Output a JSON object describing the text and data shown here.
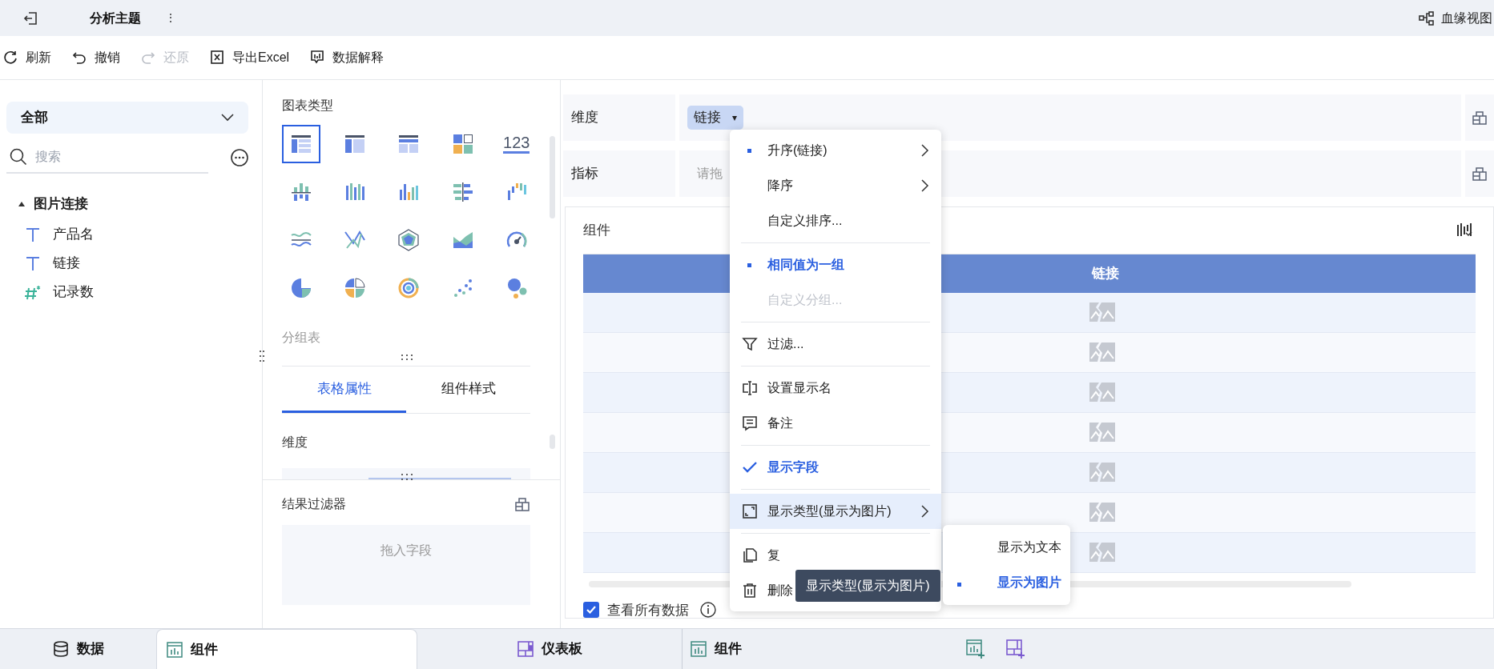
{
  "header": {
    "title": "分析主题",
    "more": "⋮",
    "lineage": "血缘视图"
  },
  "toolbar": [
    {
      "label": "刷新",
      "disabled": false
    },
    {
      "label": "撤销",
      "disabled": false
    },
    {
      "label": "还原",
      "disabled": true
    },
    {
      "label": "导出Excel",
      "disabled": false
    },
    {
      "label": "数据解释",
      "disabled": false
    }
  ],
  "sidebar": {
    "scope": "全部",
    "search": {
      "placeholder": "搜索"
    },
    "tree": [
      {
        "label": "图片连接",
        "expanded": true,
        "children": [
          {
            "label": "产品名",
            "kind": "text"
          },
          {
            "label": "链接",
            "kind": "text"
          },
          {
            "label": "记录数",
            "kind": "number"
          }
        ]
      }
    ]
  },
  "chart_panel": {
    "title": "图表类型",
    "chart_types": [
      {
        "kind": "detail-table",
        "selected": true
      },
      {
        "kind": "cross-table",
        "selected": false
      },
      {
        "kind": "group-table",
        "selected": false
      },
      {
        "kind": "blocks",
        "selected": false
      },
      {
        "kind": "number",
        "label": "123",
        "selected": false
      },
      {
        "kind": "stack-bar",
        "selected": false
      },
      {
        "kind": "multi-bar",
        "selected": false
      },
      {
        "kind": "bar",
        "selected": false
      },
      {
        "kind": "hbar",
        "selected": false
      },
      {
        "kind": "waterfall",
        "selected": false
      },
      {
        "kind": "wave",
        "selected": false
      },
      {
        "kind": "cross-line",
        "selected": false
      },
      {
        "kind": "radar",
        "selected": false
      },
      {
        "kind": "area",
        "selected": false
      },
      {
        "kind": "gauge",
        "selected": false
      },
      {
        "kind": "pie",
        "selected": false
      },
      {
        "kind": "multi-pie",
        "selected": false
      },
      {
        "kind": "ring",
        "selected": false
      },
      {
        "kind": "scatter",
        "selected": false
      },
      {
        "kind": "bubble",
        "selected": false
      }
    ],
    "current_type": "分组表",
    "tabs": [
      {
        "label": "表格属性",
        "selected": true
      },
      {
        "label": "组件样式",
        "selected": false
      }
    ],
    "dimension_label": "维度",
    "result_filter": {
      "title": "结果过滤器",
      "drop_hint": "拖入字段"
    }
  },
  "shelves": [
    {
      "label": "维度",
      "fields": [
        {
          "label": "链接",
          "caret": "▾"
        }
      ]
    },
    {
      "label": "指标",
      "placeholder": "请拖"
    }
  ],
  "component": {
    "title": "组件",
    "table": {
      "columns": [
        "链接"
      ],
      "rows": [
        {
          "kind": "image"
        },
        {
          "kind": "image"
        },
        {
          "kind": "image"
        },
        {
          "kind": "image"
        },
        {
          "kind": "image"
        },
        {
          "kind": "image"
        },
        {
          "kind": "image"
        }
      ]
    },
    "show_all": {
      "label": "查看所有数据",
      "checked": true
    }
  },
  "context_menu": [
    {
      "kind": "dot",
      "label": "升序(链接)",
      "submenu": true,
      "disabled": false,
      "hovered": false
    },
    {
      "kind": "plain",
      "label": "降序",
      "submenu": true,
      "disabled": false,
      "hovered": false
    },
    {
      "kind": "plain",
      "label": "自定义排序...",
      "submenu": false,
      "disabled": false,
      "hovered": false
    },
    {
      "kind": "divider"
    },
    {
      "kind": "chosen",
      "label": "相同值为一组",
      "submenu": false,
      "disabled": false,
      "hovered": false
    },
    {
      "kind": "plain",
      "label": "自定义分组...",
      "submenu": false,
      "disabled": true,
      "hovered": false
    },
    {
      "kind": "divider"
    },
    {
      "kind": "filter",
      "label": "过滤...",
      "submenu": false,
      "disabled": false,
      "hovered": false
    },
    {
      "kind": "divider"
    },
    {
      "kind": "rename",
      "label": "设置显示名",
      "submenu": false,
      "disabled": false,
      "hovered": false
    },
    {
      "kind": "note",
      "label": "备注",
      "submenu": false,
      "disabled": false,
      "hovered": false
    },
    {
      "kind": "divider"
    },
    {
      "kind": "check",
      "label": "显示字段",
      "submenu": false,
      "disabled": false,
      "hovered": false
    },
    {
      "kind": "divider"
    },
    {
      "kind": "display",
      "label": "显示类型(显示为图片)",
      "submenu": true,
      "disabled": false,
      "hovered": true
    },
    {
      "kind": "divider"
    },
    {
      "kind": "copy",
      "label": "复",
      "submenu": false,
      "disabled": false,
      "hovered": false
    },
    {
      "kind": "trash",
      "label": "删除",
      "disabled": false,
      "hovered": false
    }
  ],
  "submenu": [
    {
      "label": "显示为文本",
      "selected": false
    },
    {
      "label": "显示为图片",
      "selected": true
    }
  ],
  "tooltip": "显示类型(显示为图片)",
  "bottom_tabs": [
    {
      "label": "数据",
      "kind": "data",
      "selected": false
    },
    {
      "label": "组件",
      "kind": "component",
      "selected": true
    },
    {
      "label": "仪表板",
      "kind": "dashboard",
      "selected": false
    },
    {
      "label": "组件",
      "kind": "component",
      "selected": false
    }
  ]
}
